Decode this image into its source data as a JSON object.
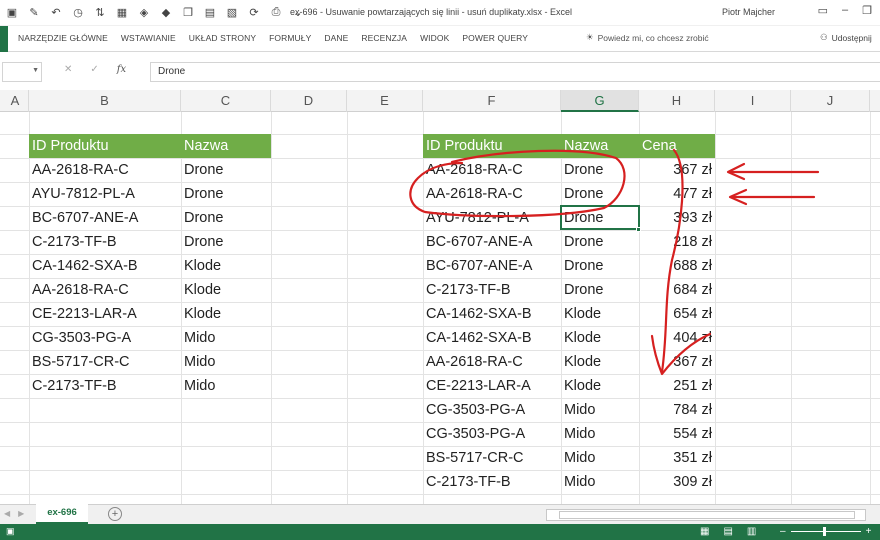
{
  "window": {
    "title": "ex-696 - Usuwanie powtarzających się linii - usuń duplikaty.xlsx - Excel",
    "user": "Piotr Majcher"
  },
  "ribbon": {
    "tabs": [
      "NARZĘDZIE GŁÓWNE",
      "WSTAWIANIE",
      "UKŁAD STRONY",
      "FORMUŁY",
      "DANE",
      "RECENZJA",
      "WIDOK",
      "POWER QUERY"
    ],
    "tell_me": "Powiedz mi, co chcesz zrobić",
    "share": "Udostępnij"
  },
  "formula_bar": {
    "name_box": "",
    "cancel": "✕",
    "enter": "✓",
    "fx": "fx",
    "value": "Drone"
  },
  "columns": [
    "A",
    "B",
    "C",
    "D",
    "E",
    "F",
    "G",
    "H",
    "I",
    "J"
  ],
  "selected_column": "G",
  "table_left": {
    "headers": [
      "ID Produktu",
      "Nazwa"
    ],
    "rows": [
      [
        "AA-2618-RA-C",
        "Drone"
      ],
      [
        "AYU-7812-PL-A",
        "Drone"
      ],
      [
        "BC-6707-ANE-A",
        "Drone"
      ],
      [
        "C-2173-TF-B",
        "Drone"
      ],
      [
        "CA-1462-SXA-B",
        "Klode"
      ],
      [
        "AA-2618-RA-C",
        "Klode"
      ],
      [
        "CE-2213-LAR-A",
        "Klode"
      ],
      [
        "CG-3503-PG-A",
        "Mido"
      ],
      [
        "BS-5717-CR-C",
        "Mido"
      ],
      [
        "C-2173-TF-B",
        "Mido"
      ]
    ]
  },
  "table_right": {
    "headers": [
      "ID Produktu",
      "Nazwa",
      "Cena"
    ],
    "rows": [
      [
        "AA-2618-RA-C",
        "Drone",
        "367 zł"
      ],
      [
        "AA-2618-RA-C",
        "Drone",
        "477 zł"
      ],
      [
        "AYU-7812-PL-A",
        "Drone",
        "393 zł"
      ],
      [
        "BC-6707-ANE-A",
        "Drone",
        "218 zł"
      ],
      [
        "BC-6707-ANE-A",
        "Drone",
        "688 zł"
      ],
      [
        "C-2173-TF-B",
        "Drone",
        "684 zł"
      ],
      [
        "CA-1462-SXA-B",
        "Klode",
        "654 zł"
      ],
      [
        "CA-1462-SXA-B",
        "Klode",
        "404 zł"
      ],
      [
        "AA-2618-RA-C",
        "Klode",
        "367 zł"
      ],
      [
        "CE-2213-LAR-A",
        "Klode",
        "251 zł"
      ],
      [
        "CG-3503-PG-A",
        "Mido",
        "784 zł"
      ],
      [
        "CG-3503-PG-A",
        "Mido",
        "554 zł"
      ],
      [
        "BS-5717-CR-C",
        "Mido",
        "351 zł"
      ],
      [
        "C-2173-TF-B",
        "Mido",
        "309 zł"
      ]
    ]
  },
  "sheet": {
    "active_tab": "ex-696",
    "add_sheet": "+"
  },
  "colors": {
    "excel_green": "#217346",
    "table_header": "#70ad47",
    "annotation": "#d62020"
  }
}
